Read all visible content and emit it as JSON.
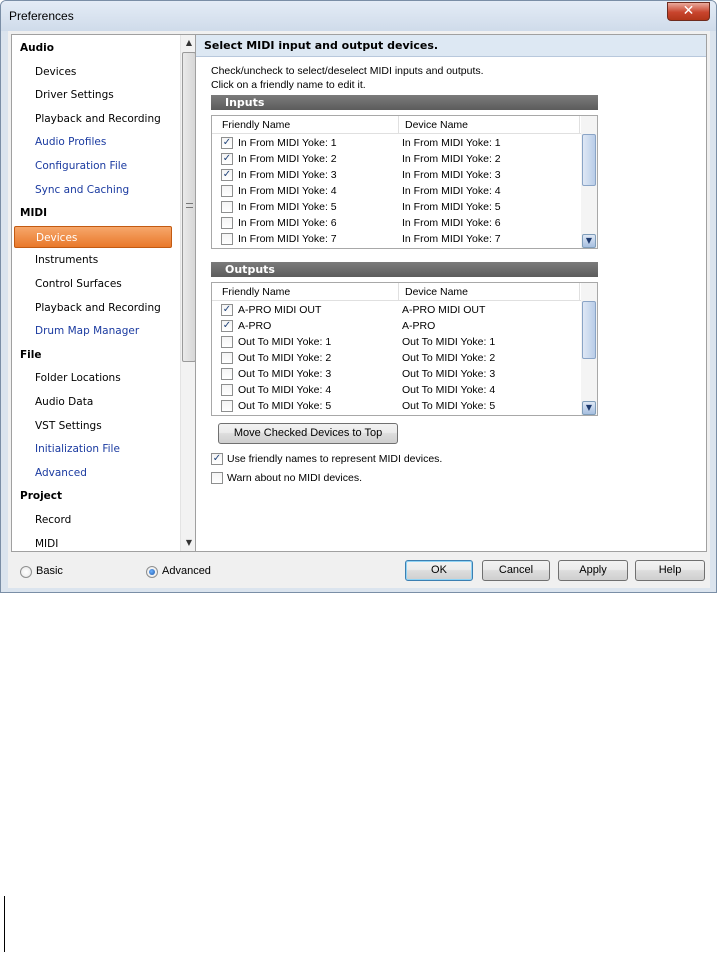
{
  "window": {
    "title": "Preferences",
    "close_glyph": "✕"
  },
  "tree": {
    "items": [
      {
        "label": "Audio",
        "kind": "head"
      },
      {
        "label": "Devices",
        "kind": "child"
      },
      {
        "label": "Driver Settings",
        "kind": "child"
      },
      {
        "label": "Playback and Recording",
        "kind": "child"
      },
      {
        "label": "Audio Profiles",
        "kind": "link"
      },
      {
        "label": "Configuration File",
        "kind": "link"
      },
      {
        "label": "Sync and Caching",
        "kind": "link"
      },
      {
        "label": "MIDI",
        "kind": "head"
      },
      {
        "label": "Devices",
        "kind": "selected"
      },
      {
        "label": "Instruments",
        "kind": "child"
      },
      {
        "label": "Control Surfaces",
        "kind": "child"
      },
      {
        "label": "Playback and Recording",
        "kind": "child"
      },
      {
        "label": "Drum Map Manager",
        "kind": "link"
      },
      {
        "label": "File",
        "kind": "head"
      },
      {
        "label": "Folder Locations",
        "kind": "child"
      },
      {
        "label": "Audio Data",
        "kind": "child"
      },
      {
        "label": "VST Settings",
        "kind": "child"
      },
      {
        "label": "Initialization File",
        "kind": "link"
      },
      {
        "label": "Advanced",
        "kind": "link"
      },
      {
        "label": "Project",
        "kind": "head"
      },
      {
        "label": "Record",
        "kind": "child"
      },
      {
        "label": "MIDI",
        "kind": "child"
      }
    ]
  },
  "panel": {
    "header": "Select MIDI input and output devices.",
    "instruction_1": "Check/uncheck to select/deselect MIDI inputs and outputs.",
    "instruction_2": "Click on a friendly name to edit it.",
    "inputs_title": "Inputs",
    "outputs_title": "Outputs",
    "col_friendly": "Friendly Name",
    "col_device": "Device Name",
    "inputs": [
      {
        "friendly": "In From MIDI Yoke:  1",
        "device": "In From MIDI Yoke:  1",
        "checked": true
      },
      {
        "friendly": "In From MIDI Yoke:  2",
        "device": "In From MIDI Yoke:  2",
        "checked": true
      },
      {
        "friendly": "In From MIDI Yoke:  3",
        "device": "In From MIDI Yoke:  3",
        "checked": true
      },
      {
        "friendly": "In From MIDI Yoke:  4",
        "device": "In From MIDI Yoke:  4",
        "checked": false
      },
      {
        "friendly": "In From MIDI Yoke:  5",
        "device": "In From MIDI Yoke:  5",
        "checked": false
      },
      {
        "friendly": "In From MIDI Yoke:  6",
        "device": "In From MIDI Yoke:  6",
        "checked": false
      },
      {
        "friendly": "In From MIDI Yoke:  7",
        "device": "In From MIDI Yoke:  7",
        "checked": false
      }
    ],
    "outputs": [
      {
        "friendly": "A-PRO MIDI OUT",
        "device": "A-PRO MIDI OUT",
        "checked": true
      },
      {
        "friendly": "A-PRO",
        "device": "A-PRO",
        "checked": true
      },
      {
        "friendly": "Out To MIDI Yoke:  1",
        "device": "Out To MIDI Yoke:  1",
        "checked": false
      },
      {
        "friendly": "Out To MIDI Yoke:  2",
        "device": "Out To MIDI Yoke:  2",
        "checked": false
      },
      {
        "friendly": "Out To MIDI Yoke:  3",
        "device": "Out To MIDI Yoke:  3",
        "checked": false
      },
      {
        "friendly": "Out To MIDI Yoke:  4",
        "device": "Out To MIDI Yoke:  4",
        "checked": false
      },
      {
        "friendly": "Out To MIDI Yoke:  5",
        "device": "Out To MIDI Yoke:  5",
        "checked": false
      }
    ],
    "move_button": "Move Checked Devices to Top",
    "option_friendly": {
      "label": "Use friendly names to represent MIDI devices.",
      "checked": true
    },
    "option_warn": {
      "label": "Warn about no MIDI devices.",
      "checked": false
    }
  },
  "footer": {
    "radio_basic": "Basic",
    "radio_advanced": "Advanced",
    "selected_mode": "Advanced",
    "ok": "OK",
    "cancel": "Cancel",
    "apply": "Apply",
    "help": "Help"
  },
  "glyphs": {
    "check": "✓",
    "up": "▲",
    "down": "▼"
  }
}
